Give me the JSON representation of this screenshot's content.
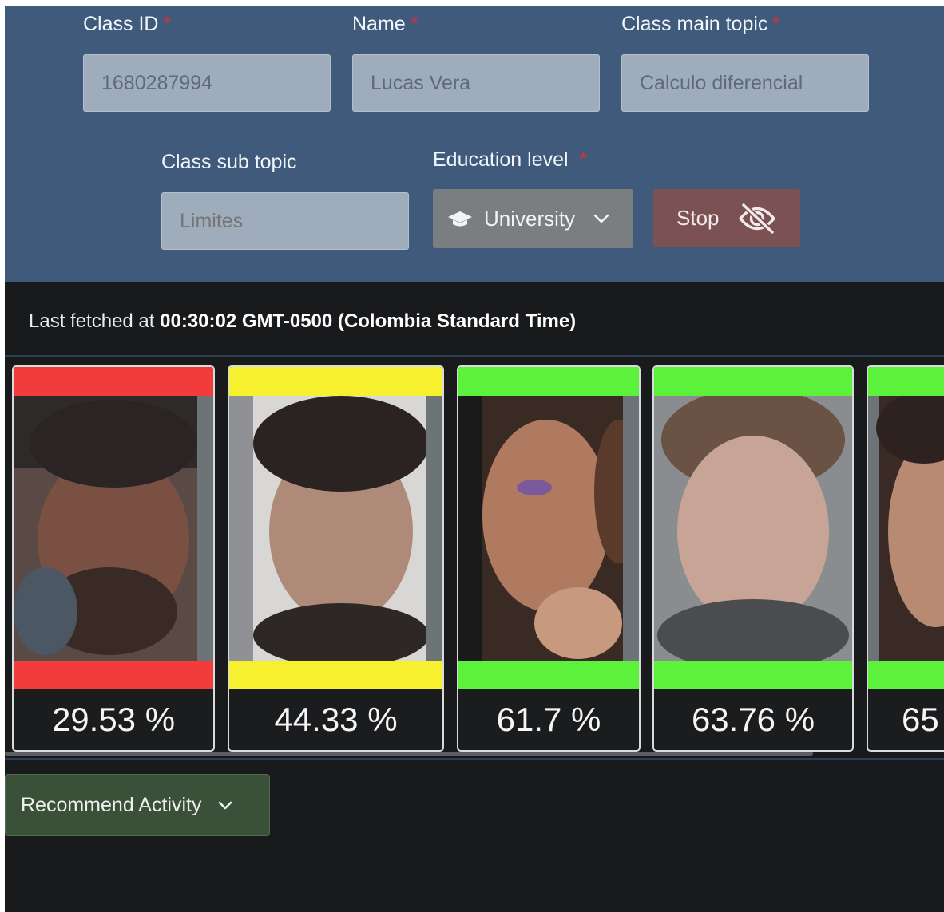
{
  "form": {
    "class_id": {
      "label": "Class ID",
      "value": "1680287994"
    },
    "name": {
      "label": "Name",
      "value": "Lucas Vera"
    },
    "main_topic": {
      "label": "Class main topic",
      "value": "Calculo diferencial"
    },
    "sub_topic": {
      "label": "Class sub topic",
      "placeholder": "Limites"
    },
    "education_level": {
      "label": "Education level",
      "selected": "University",
      "icon": "graduation-cap-icon"
    },
    "required_marker": "*",
    "stop_button": {
      "label": "Stop",
      "icon": "eye-slash-icon"
    }
  },
  "status": {
    "prefix": "Last fetched at",
    "time": "00:30:02 GMT-0500 (Colombia Standard Time)"
  },
  "students": [
    {
      "percent": "29.53 %",
      "status_color": "#f23c3c"
    },
    {
      "percent": "44.33 %",
      "status_color": "#f7f02e"
    },
    {
      "percent": "61.7 %",
      "status_color": "#5cf23b"
    },
    {
      "percent": "63.76 %",
      "status_color": "#5cf23b"
    },
    {
      "percent": "65",
      "status_color": "#5cf23b"
    }
  ],
  "recommend": {
    "label": "Recommend Activity",
    "icon": "chevron-down-icon"
  },
  "colors": {
    "form_bg": "#3f5a7a",
    "page_bg": "#191a1c",
    "stop_bg": "#7b5154",
    "recommend_bg": "#3b5039"
  }
}
